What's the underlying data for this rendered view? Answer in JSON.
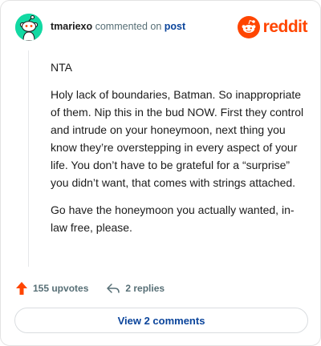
{
  "header": {
    "username": "tmariexo",
    "action_text": "commented on",
    "post_link": "post",
    "brand_name": "reddit"
  },
  "comment": {
    "paragraphs": [
      "NTA",
      "Holy lack of boundaries, Batman. So inappropriate of them. Nip this in the bud NOW. First they control and intrude on your honeymoon, next thing you know they’re overstepping in every aspect of your life. You don’t have to be grateful for a “surprise” you didn’t want, that comes with strings attached.",
      "Go have the honeymoon you actually wanted, in-law free, please."
    ]
  },
  "actions": {
    "upvotes": "155 upvotes",
    "replies": "2 replies"
  },
  "footer": {
    "view_comments_label": "View 2 comments"
  },
  "colors": {
    "avatar_bg": "#12d9a3",
    "brand": "#ff4500",
    "link": "#0a449b",
    "muted": "#576f76"
  },
  "icons": {
    "avatar": "snoo-avatar-icon",
    "logo": "reddit-logo-icon",
    "upvote": "upvote-arrow-icon",
    "reply": "reply-arrow-icon"
  }
}
